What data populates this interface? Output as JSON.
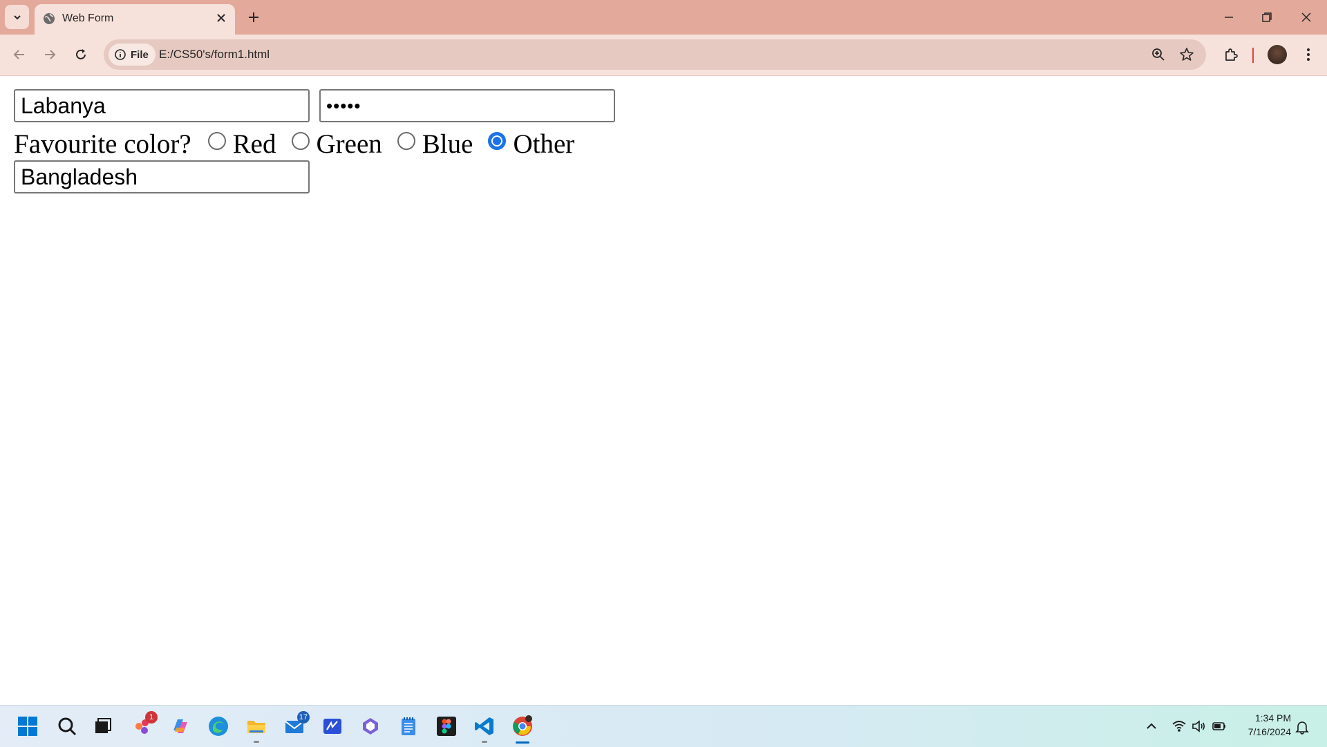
{
  "browser": {
    "tab_title": "Web Form",
    "site_chip": "File",
    "url": "E:/CS50's/form1.html"
  },
  "form": {
    "name_value": "Labanya",
    "password_mask": "•••••",
    "color_question": "Favourite color?",
    "color_options": [
      "Red",
      "Green",
      "Blue",
      "Other"
    ],
    "selected_color": "Other",
    "country_value": "Bangladesh"
  },
  "taskbar": {
    "notification_badge": "1",
    "mail_badge": "17",
    "time": "1:34 PM",
    "date": "7/16/2024"
  },
  "colors": {
    "tabstrip": "#e3a99a",
    "toolbar": "#f7e1db",
    "radio_accent": "#1a73e8"
  }
}
